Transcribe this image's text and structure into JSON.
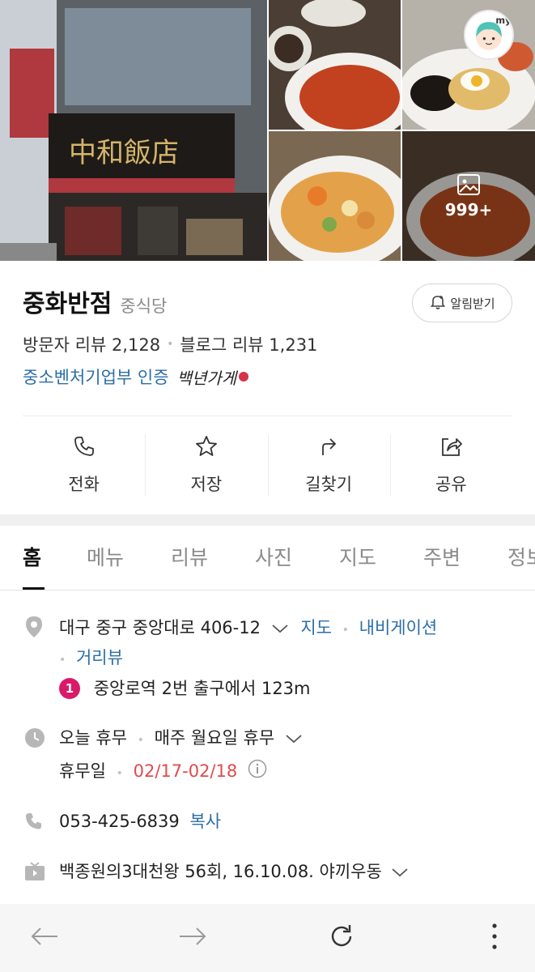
{
  "photos": {
    "more_count": "999+"
  },
  "my_badge_label": "my",
  "place": {
    "name": "중화반점",
    "category": "중식당",
    "alarm_label": "알림받기",
    "visitor_review_label": "방문자 리뷰 2,128",
    "blog_review_label": "블로그 리뷰 1,231",
    "certification": "중소벤처기업부 인증",
    "certification_mark": "백년가게"
  },
  "actions": [
    {
      "label": "전화",
      "icon": "phone-icon"
    },
    {
      "label": "저장",
      "icon": "star-icon"
    },
    {
      "label": "길찾기",
      "icon": "directions-icon"
    },
    {
      "label": "공유",
      "icon": "share-icon"
    }
  ],
  "tabs": [
    {
      "label": "홈",
      "active": true
    },
    {
      "label": "메뉴"
    },
    {
      "label": "리뷰"
    },
    {
      "label": "사진"
    },
    {
      "label": "지도"
    },
    {
      "label": "주변"
    },
    {
      "label": "정보"
    }
  ],
  "details": {
    "address": "대구 중구 중앙대로 406-12",
    "map_link": "지도",
    "navigation_link": "내비게이션",
    "street_view_link": "거리뷰",
    "subway_line": "1",
    "subway_text": "중앙로역 2번 출구에서 123m",
    "hours_today": "오늘 휴무",
    "hours_weekly": "매주 월요일 휴무",
    "holiday_label": "휴무일",
    "holiday_dates": "02/17-02/18",
    "phone": "053-425-6839",
    "copy_label": "복사",
    "tv_show": "백종원의3대천왕 56회, 16.10.08. 야끼우동"
  },
  "colors": {
    "link": "#2c6ea8",
    "holiday": "#e04b4b",
    "subway_line_1": "#d91a6b"
  }
}
